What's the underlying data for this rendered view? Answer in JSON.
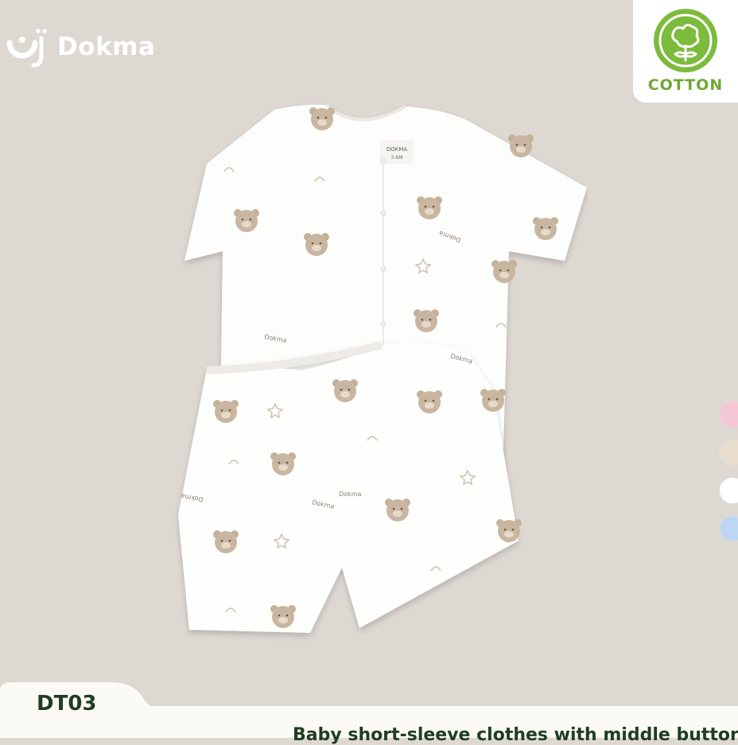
{
  "brand": {
    "name": "Dokma",
    "logo_icon": "dokma-logo-icon"
  },
  "badge": {
    "label": "COTTON",
    "icon": "cotton-flower-icon",
    "color": "#79b73a"
  },
  "product": {
    "code": "DT03",
    "title": "Baby short-sleeve clothes with middle buttons",
    "image": "white-bear-print-shirt-and-shorts-set",
    "tag_brand": "DOKMA",
    "tag_size": "3-6M",
    "print_text": "Dokma"
  },
  "color_options": [
    {
      "name": "pink",
      "hex": "#f5c6d6"
    },
    {
      "name": "beige",
      "hex": "#e8dccc"
    },
    {
      "name": "white",
      "hex": "#ffffff"
    },
    {
      "name": "blue",
      "hex": "#bfd6f2"
    }
  ],
  "colors": {
    "background": "#ded8d3",
    "accent_green": "#1f3d25",
    "footer": "#fbfaf4"
  }
}
